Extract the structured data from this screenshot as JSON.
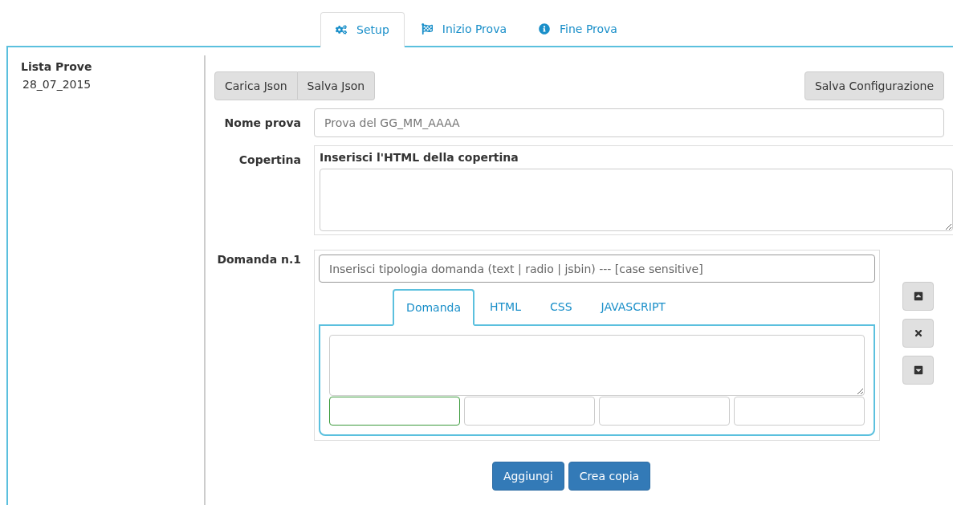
{
  "tabs": [
    {
      "label": "Setup",
      "kind": "gears",
      "selected": true
    },
    {
      "label": "Inizio Prova",
      "kind": "flag",
      "selected": false
    },
    {
      "label": "Fine Prova",
      "kind": "info",
      "selected": false
    }
  ],
  "sidebar": {
    "title": "Lista Prove",
    "items": [
      "28_07_2015"
    ]
  },
  "toolbar": {
    "left_buttons": [
      "Carica Json",
      "Salva Json"
    ],
    "right_button": "Salva Configurazione"
  },
  "nome_prova": {
    "label": "Nome prova",
    "placeholder": "Prova del GG_MM_AAAA"
  },
  "copertina": {
    "label": "Copertina",
    "heading": "Inserisci l'HTML della copertina"
  },
  "domanda": {
    "label": "Domanda n.1",
    "placeholder": "Inserisci tipologia domanda (text | radio | jsbin) --- [case sensitive]",
    "tabs": [
      {
        "label": "Domanda",
        "selected": true
      },
      {
        "label": "HTML",
        "selected": false
      },
      {
        "label": "CSS",
        "selected": false
      },
      {
        "label": "JAVASCRIPT",
        "selected": false
      }
    ],
    "answers": [
      {
        "focused": true
      },
      {
        "focused": false
      },
      {
        "focused": false
      },
      {
        "focused": false
      }
    ],
    "side_buttons": [
      {
        "kind": "up"
      },
      {
        "kind": "remove"
      },
      {
        "kind": "down"
      }
    ]
  },
  "bottom_buttons": [
    "Aggiungi",
    "Crea copia"
  ]
}
